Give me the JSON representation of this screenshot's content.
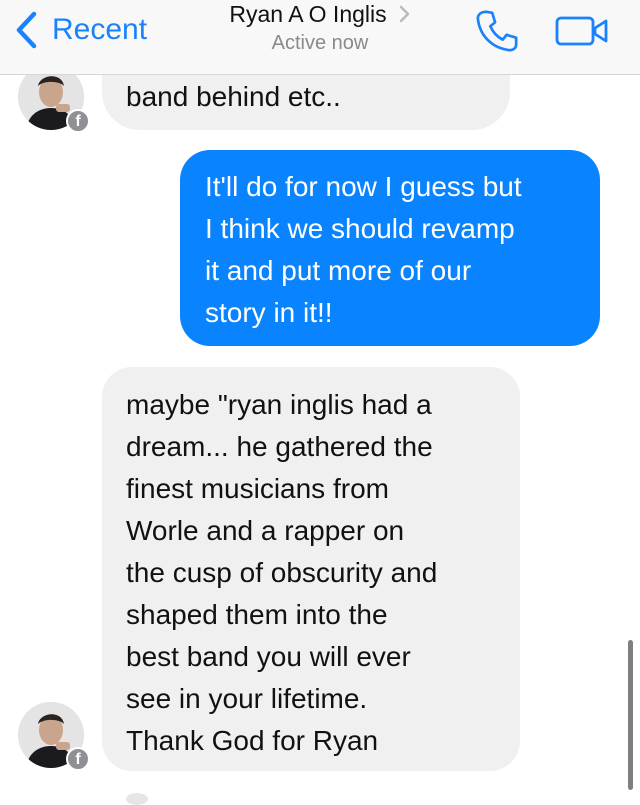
{
  "header": {
    "back_label": "Recent",
    "contact_name": "Ryan A O Inglis",
    "status": "Active now",
    "accent_color": "#1a82fb",
    "icons": [
      "chevron-left-icon",
      "chevron-right-icon",
      "phone-icon",
      "video-camera-icon"
    ]
  },
  "messages": [
    {
      "sender": "contact",
      "lines": [
        "band behind etc.."
      ]
    },
    {
      "sender": "me",
      "lines": [
        "It'll do for now I guess but",
        "I think we should revamp",
        "it and put more of our",
        "story in it!!"
      ]
    },
    {
      "sender": "contact",
      "lines": [
        "maybe \"ryan inglis had a",
        "dream... he gathered the",
        "finest musicians from",
        "Worle and a rapper on",
        "the cusp of obscurity and",
        "shaped them into the",
        "best band you will ever",
        "see in your lifetime.",
        "Thank God for Ryan"
      ]
    }
  ],
  "avatar_badge": "f",
  "colors": {
    "sent_bubble": "#0a84fe",
    "received_bubble": "#f1f0f0"
  }
}
